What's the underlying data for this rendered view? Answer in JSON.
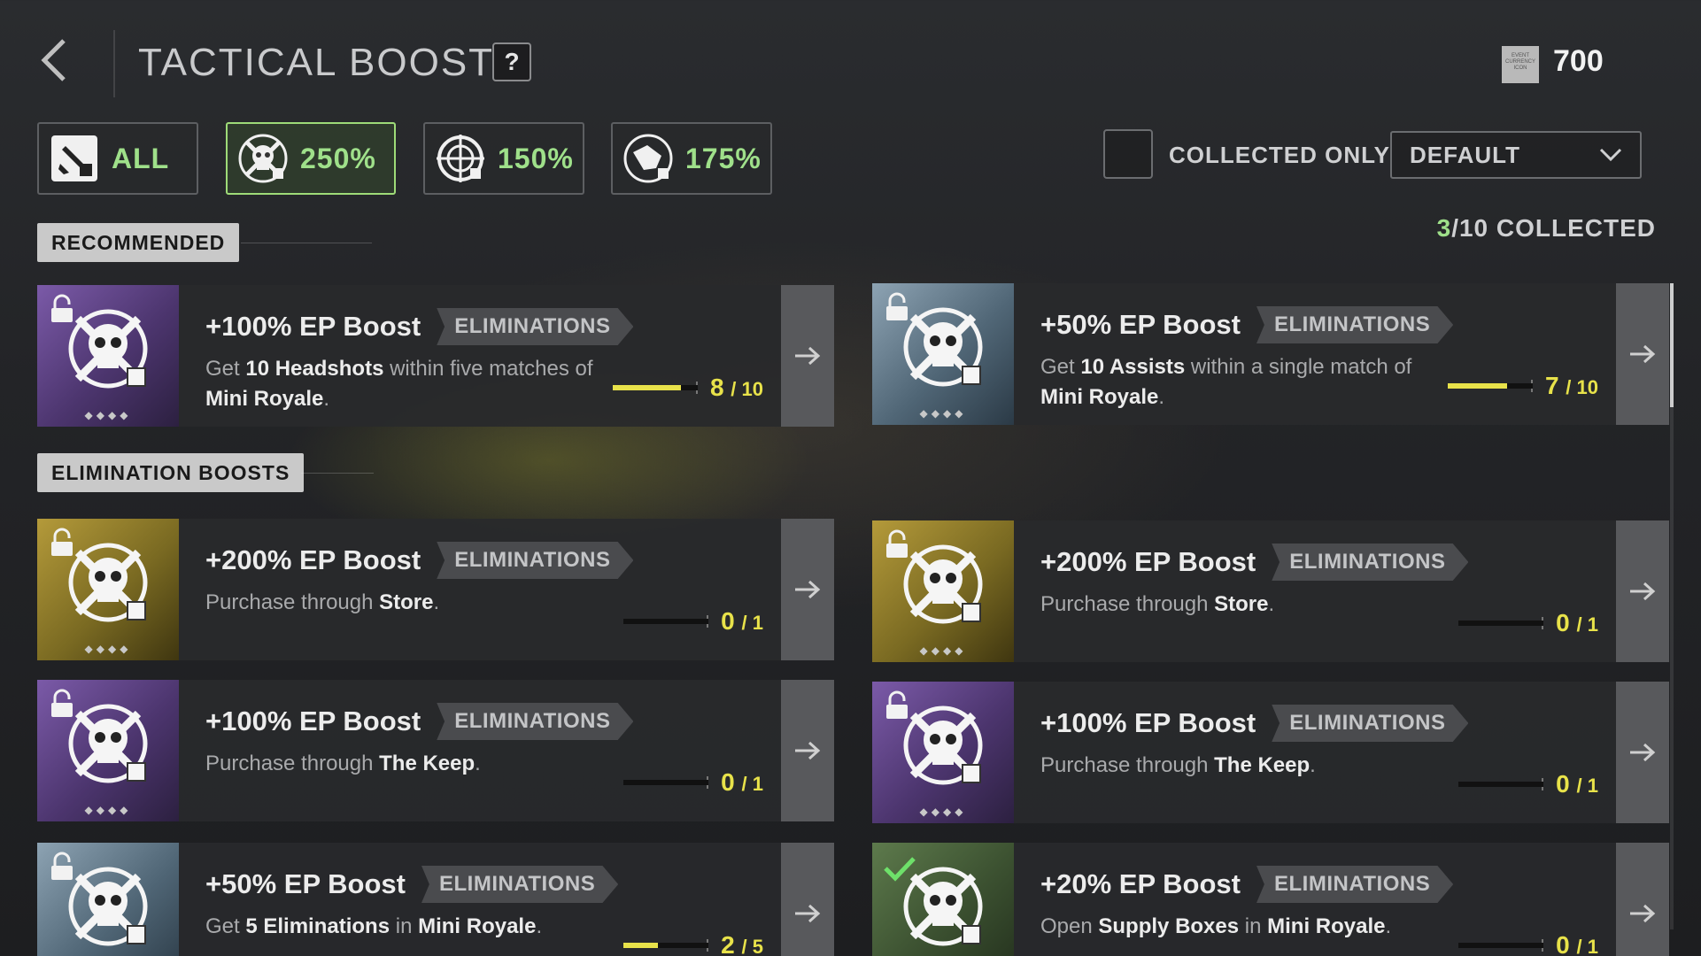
{
  "header": {
    "title": "TACTICAL BOOSTS",
    "help_label": "?",
    "currency_icon_text": "EVENT CURRENCY ICON",
    "currency_value": "700"
  },
  "filters": [
    {
      "label": "ALL",
      "icon": "all-boosts-icon",
      "active": false
    },
    {
      "label": "250%",
      "icon": "skull-boost-icon",
      "active": true
    },
    {
      "label": "150%",
      "icon": "crosshair-boost-icon",
      "active": false
    },
    {
      "label": "175%",
      "icon": "handshake-boost-icon",
      "active": false
    }
  ],
  "collected_only": {
    "label": "COLLECTED ONLY",
    "checked": false
  },
  "sort": {
    "selected": "DEFAULT"
  },
  "collected": {
    "count": "3",
    "suffix": "/10 COLLECTED"
  },
  "sections": {
    "recommended": "RECOMMENDED",
    "elimination_boosts": "ELIMINATION BOOSTS"
  },
  "colors": {
    "accent_green": "#9fe08a",
    "progress_yellow": "#e8e24a",
    "card_bg": "#28292c"
  },
  "cards": [
    {
      "title": "+100% EP Boost",
      "tag": "ELIMINATIONS",
      "rarity": "purple",
      "status": "locked",
      "desc": {
        "pre": "Get ",
        "b1": "10 Headshots",
        "mid": " within five matches of ",
        "b2": "Mini Royale",
        "post": "."
      },
      "progress": "8",
      "total": "/ 10",
      "fraction": 0.8
    },
    {
      "title": "+50% EP Boost",
      "tag": "ELIMINATIONS",
      "rarity": "blue",
      "status": "locked",
      "desc": {
        "pre": "Get ",
        "b1": "10 Assists",
        "mid": " within a single match of ",
        "b2": "Mini Royale",
        "post": "."
      },
      "progress": "7",
      "total": "/ 10",
      "fraction": 0.7
    },
    {
      "title": "+200% EP Boost",
      "tag": "ELIMINATIONS",
      "rarity": "gold",
      "status": "locked",
      "desc": {
        "pre": "Purchase through ",
        "b1": "Store",
        "mid": "",
        "b2": "",
        "post": "."
      },
      "progress": "0",
      "total": "/ 1",
      "fraction": 0
    },
    {
      "title": "+200% EP Boost",
      "tag": "ELIMINATIONS",
      "rarity": "gold",
      "status": "locked",
      "desc": {
        "pre": "Purchase through ",
        "b1": "Store",
        "mid": "",
        "b2": "",
        "post": "."
      },
      "progress": "0",
      "total": "/ 1",
      "fraction": 0
    },
    {
      "title": "+100% EP Boost",
      "tag": "ELIMINATIONS",
      "rarity": "purple",
      "status": "locked",
      "desc": {
        "pre": "Purchase through ",
        "b1": "The Keep",
        "mid": "",
        "b2": "",
        "post": "."
      },
      "progress": "0",
      "total": "/ 1",
      "fraction": 0
    },
    {
      "title": "+100% EP Boost",
      "tag": "ELIMINATIONS",
      "rarity": "purple",
      "status": "locked",
      "desc": {
        "pre": "Purchase through ",
        "b1": "The Keep",
        "mid": "",
        "b2": "",
        "post": "."
      },
      "progress": "0",
      "total": "/ 1",
      "fraction": 0
    },
    {
      "title": "+50% EP Boost",
      "tag": "ELIMINATIONS",
      "rarity": "blue",
      "status": "locked",
      "desc": {
        "pre": "Get ",
        "b1": "5 Eliminations",
        "mid": " in ",
        "b2": "Mini Royale",
        "post": "."
      },
      "progress": "2",
      "total": "/ 5",
      "fraction": 0.4
    },
    {
      "title": "+20% EP Boost",
      "tag": "ELIMINATIONS",
      "rarity": "green",
      "status": "collected",
      "desc": {
        "pre": "Open ",
        "b1": "Supply Boxes",
        "mid": " in ",
        "b2": "Mini Royale",
        "post": "."
      },
      "progress": "0",
      "total": "/ 1",
      "fraction": 0
    }
  ]
}
